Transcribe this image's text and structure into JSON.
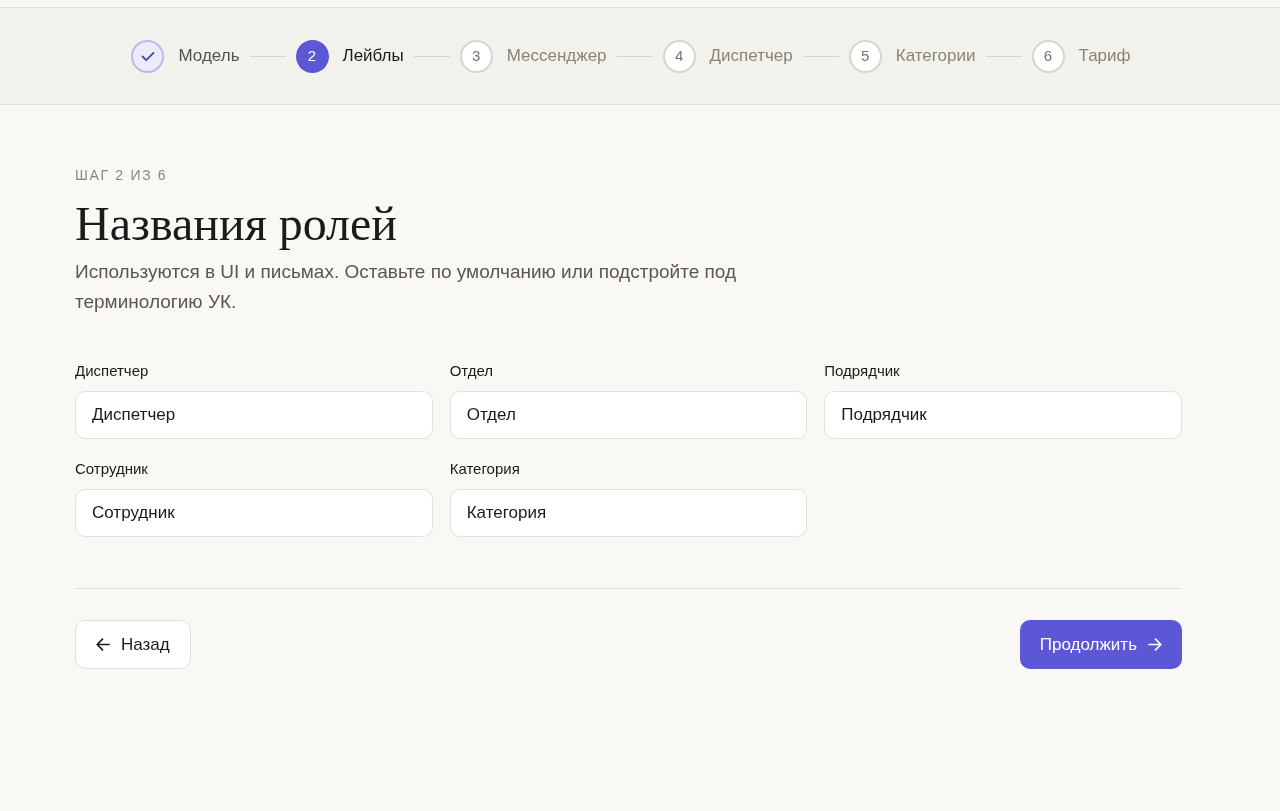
{
  "stepper": {
    "steps": [
      {
        "label": "Модель",
        "completed": true,
        "selected": false
      },
      {
        "number": "2",
        "label": "Лейблы",
        "completed": false,
        "selected": true
      },
      {
        "number": "3",
        "label": "Мессенджер",
        "completed": false,
        "selected": false
      },
      {
        "number": "4",
        "label": "Диспетчер",
        "completed": false,
        "selected": false
      },
      {
        "number": "5",
        "label": "Категории",
        "completed": false,
        "selected": false
      },
      {
        "number": "6",
        "label": "Тариф",
        "completed": false,
        "selected": false
      }
    ]
  },
  "header": {
    "eyebrow": "ШАГ 2 ИЗ 6",
    "title": "Названия ролей",
    "description": "Используются в UI и письмах. Оставьте по умолчанию или подстройте под терминологию УК."
  },
  "fields": [
    {
      "label": "Диспетчер",
      "value": "Диспетчер"
    },
    {
      "label": "Отдел",
      "value": "Отдел"
    },
    {
      "label": "Подрядчик",
      "value": "Подрядчик"
    },
    {
      "label": "Сотрудник",
      "value": "Сотрудник"
    },
    {
      "label": "Категория",
      "value": "Категория"
    }
  ],
  "footer": {
    "back_button": {
      "label": "Назад"
    },
    "continue_button": {
      "label": "Продолжить"
    }
  }
}
